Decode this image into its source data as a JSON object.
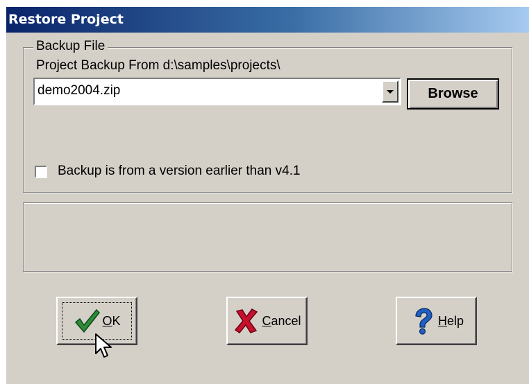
{
  "window": {
    "title": "Restore Project"
  },
  "group": {
    "legend": "Backup File",
    "path_label": "Project Backup From d:\\samples\\projects\\",
    "file_value": "demo2004.zip",
    "browse_label": "Browse",
    "checkbox_label": "Backup is from a version earlier than v4.1",
    "checkbox_checked": false
  },
  "buttons": {
    "ok": {
      "mnemonic": "O",
      "rest": "K",
      "icon": "checkmark-icon"
    },
    "cancel": {
      "mnemonic": "C",
      "rest": "ancel",
      "icon": "red-x-icon"
    },
    "help": {
      "mnemonic": "H",
      "rest": "elp",
      "icon": "question-mark-icon"
    }
  },
  "colors": {
    "title_start": "#0a246a",
    "title_end": "#a6caf0",
    "face": "#d4d0c8",
    "ok_green": "#2e8b3a",
    "cancel_red": "#c8102e",
    "help_blue": "#1f5fbf"
  }
}
